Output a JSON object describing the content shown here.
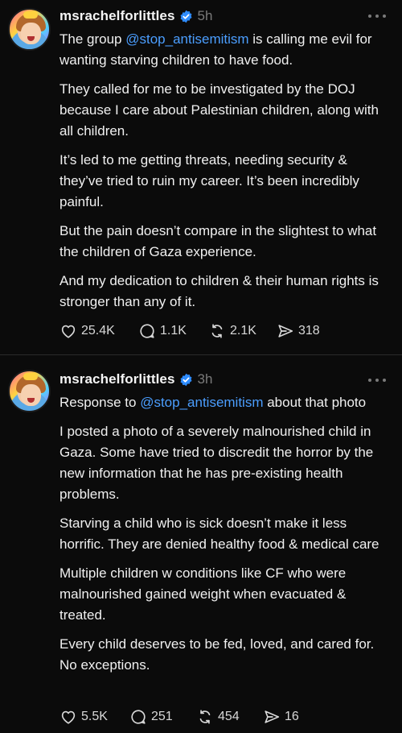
{
  "colors": {
    "background": "#0b0b0b",
    "mention": "#4b9eff",
    "verified": "#2e8cff",
    "muted": "#7a7a7a"
  },
  "posts": [
    {
      "username": "msrachelforlittles",
      "time": "5h",
      "paragraphs": [
        [
          {
            "t": "The group "
          },
          {
            "t": "@stop_antisemitism",
            "mention": true
          },
          {
            "t": " is calling me evil for wanting starving children to have food."
          }
        ],
        [
          {
            "t": "They called for me to be investigated by the DOJ because I care about Palestinian children, along with all children."
          }
        ],
        [
          {
            "t": "It’s led to me getting threats, needing security & they’ve tried to ruin my career. It’s been incredibly painful."
          }
        ],
        [
          {
            "t": "But the pain doesn’t compare in the slightest to what the children of Gaza experience."
          }
        ],
        [
          {
            "t": "And my dedication to children & their human rights is stronger than any of it."
          }
        ]
      ],
      "likes": "25.4K",
      "replies": "1.1K",
      "reposts": "2.1K",
      "shares": "318"
    },
    {
      "username": "msrachelforlittles",
      "time": "3h",
      "paragraphs": [
        [
          {
            "t": "Response to "
          },
          {
            "t": "@stop_antisemitism",
            "mention": true
          },
          {
            "t": " about that photo"
          }
        ],
        [
          {
            "t": "I posted a photo of a severely malnourished child in Gaza. Some have tried to discredit the horror by the new information that he has pre-existing health problems."
          }
        ],
        [
          {
            "t": "Starving a child who is sick doesn’t make it less horrific. They are denied healthy food & medical care"
          }
        ],
        [
          {
            "t": "Multiple children w conditions like CF who were malnourished gained weight when evacuated & treated."
          }
        ],
        [
          {
            "t": "Every child deserves to be fed, loved, and cared for. No exceptions."
          }
        ]
      ],
      "likes": "5.5K",
      "replies": "251",
      "reposts": "454",
      "shares": "16"
    }
  ]
}
